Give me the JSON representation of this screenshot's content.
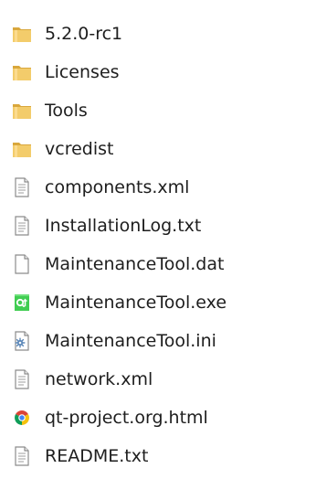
{
  "files": [
    {
      "name": "5.2.0-rc1",
      "icon": "folder-icon"
    },
    {
      "name": "Licenses",
      "icon": "folder-icon"
    },
    {
      "name": "Tools",
      "icon": "folder-icon"
    },
    {
      "name": "vcredist",
      "icon": "folder-icon"
    },
    {
      "name": "components.xml",
      "icon": "text-document-icon"
    },
    {
      "name": "InstallationLog.txt",
      "icon": "text-document-icon"
    },
    {
      "name": "MaintenanceTool.dat",
      "icon": "blank-document-icon"
    },
    {
      "name": "MaintenanceTool.exe",
      "icon": "qt-app-icon"
    },
    {
      "name": "MaintenanceTool.ini",
      "icon": "settings-document-icon"
    },
    {
      "name": "network.xml",
      "icon": "text-document-icon"
    },
    {
      "name": "qt-project.org.html",
      "icon": "chrome-icon"
    },
    {
      "name": "README.txt",
      "icon": "text-document-icon"
    }
  ],
  "colors": {
    "folder_front": "#f3cc6b",
    "folder_back": "#d9a73c",
    "document_border": "#8c8c8c",
    "document_lines": "#9d9d9d",
    "qt_green": "#41cd52",
    "chrome_red": "#db4437",
    "chrome_yellow": "#f4c20d",
    "chrome_green": "#0f9d58",
    "chrome_blue": "#4285f4"
  }
}
